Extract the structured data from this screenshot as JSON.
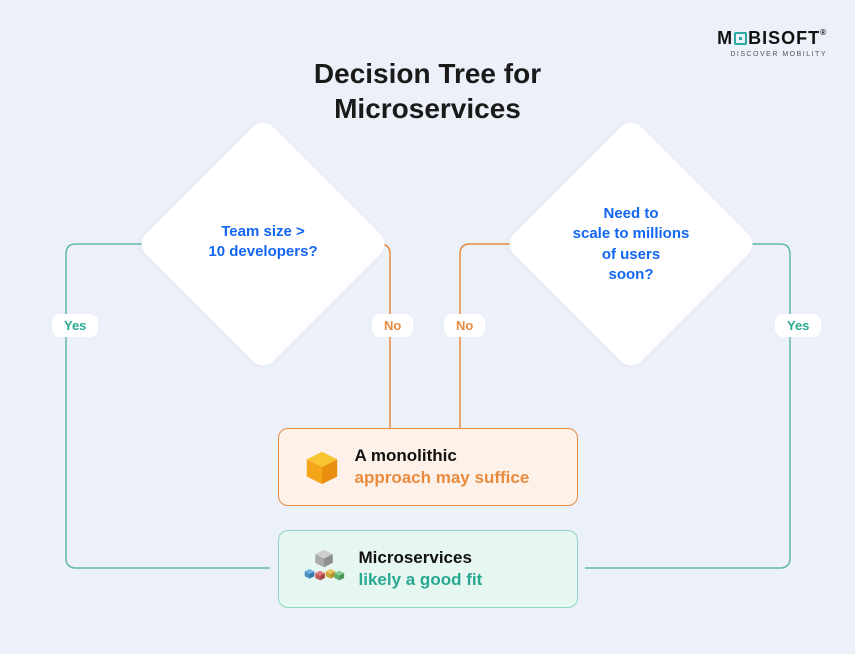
{
  "logo": {
    "brand": "MOBISOFT",
    "tagline": "DISCOVER MOBILITY"
  },
  "title": "Decision Tree for\nMicroservices",
  "nodes": {
    "team_size": {
      "line1": "Team size >",
      "line2": "10 developers?"
    },
    "scale": {
      "line1": "Need to",
      "line2": "scale to millions",
      "line3": "of users",
      "line4": "soon?"
    }
  },
  "edges": {
    "team_yes": "Yes",
    "team_no": "No",
    "scale_no": "No",
    "scale_yes": "Yes"
  },
  "results": {
    "monolith": {
      "line1": "A monolithic",
      "line2": "approach may suffice"
    },
    "microservices": {
      "line1": "Microservices",
      "line2": "likely a good fit"
    }
  },
  "chart_data": {
    "type": "flowchart",
    "title": "Decision Tree for Microservices",
    "nodes": [
      {
        "id": "q_team",
        "kind": "decision",
        "text": "Team size > 10 developers?"
      },
      {
        "id": "q_scale",
        "kind": "decision",
        "text": "Need to scale to millions of users soon?"
      },
      {
        "id": "r_mono",
        "kind": "terminal",
        "text": "A monolithic approach may suffice"
      },
      {
        "id": "r_micro",
        "kind": "terminal",
        "text": "Microservices likely a good fit"
      }
    ],
    "edges": [
      {
        "from": "q_team",
        "to": "r_micro",
        "label": "Yes"
      },
      {
        "from": "q_team",
        "to": "r_mono",
        "label": "No"
      },
      {
        "from": "q_scale",
        "to": "r_mono",
        "label": "No"
      },
      {
        "from": "q_scale",
        "to": "r_micro",
        "label": "Yes"
      }
    ]
  }
}
